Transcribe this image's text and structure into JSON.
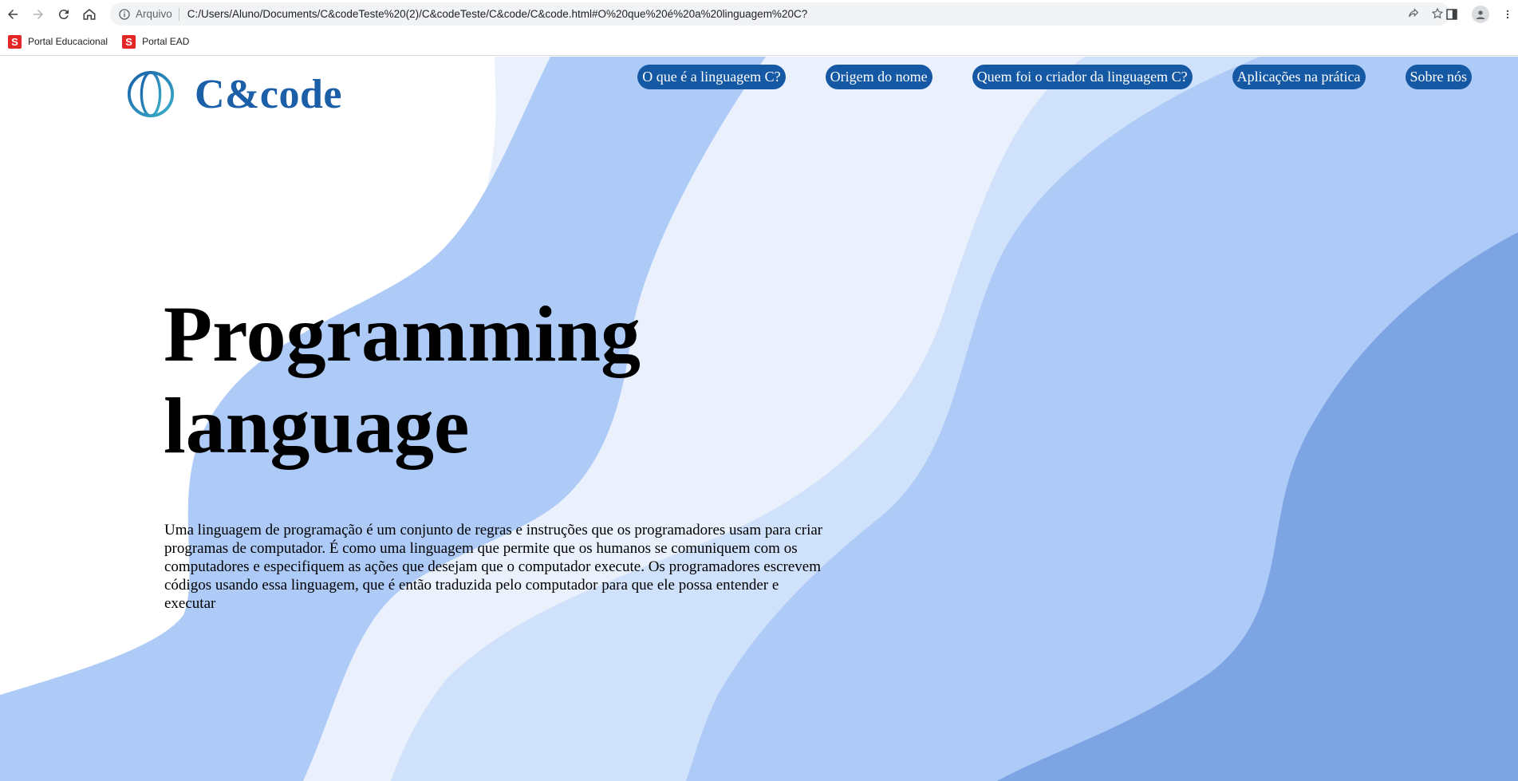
{
  "browser": {
    "scheme_label": "Arquivo",
    "url": "C:/Users/Aluno/Documents/C&codeTeste%20(2)/C&codeTeste/C&code/C&code.html#O%20que%20é%20a%20linguagem%20C?",
    "bookmarks": [
      {
        "label": "Portal Educacional",
        "icon": "S"
      },
      {
        "label": "Portal EAD",
        "icon": "S"
      }
    ]
  },
  "site": {
    "brand": "C&code",
    "nav": [
      "O que é a linguagem C?",
      "Origem do nome",
      "Quem foi o criador da linguagem C?",
      "Aplicações na prática",
      "Sobre nós"
    ],
    "hero": {
      "title_line1": "Programming",
      "title_line2": "language",
      "text": "Uma linguagem de programação é um conjunto de regras e instruções que os programadores usam para criar programas de computador. É como uma linguagem que permite que os humanos se comuniquem com os computadores e especifiquem as ações que desejam que o computador execute. Os programadores escrevem códigos usando essa linguagem, que é então traduzida pelo computador para que ele possa entender e executar"
    }
  },
  "colors": {
    "brand_blue": "#1a5fa8",
    "nav_pill": "#1558a4",
    "wave_light": "#eaf1fd",
    "wave_mid": "#aecbf8",
    "wave_pale": "#d0e1fb",
    "wave_dark": "#7ea5e3"
  }
}
